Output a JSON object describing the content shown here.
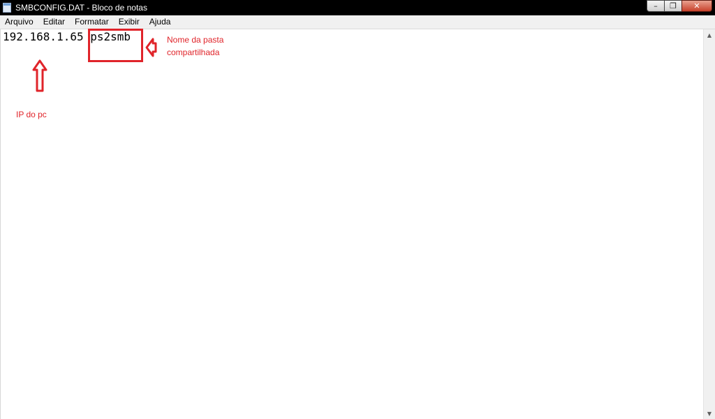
{
  "window": {
    "title": "SMBCONFIG.DAT - Bloco de notas",
    "minimize_glyph": "–",
    "maximize_glyph": "❐",
    "close_glyph": "✕"
  },
  "menu": {
    "items": [
      "Arquivo",
      "Editar",
      "Formatar",
      "Exibir",
      "Ajuda"
    ]
  },
  "editor": {
    "content": "192.168.1.65 ps2smb"
  },
  "annotations": {
    "folder_label": "Nome da pasta compartilhada",
    "ip_label": "IP do pc",
    "color": "#e0242a"
  },
  "scrollbar": {
    "up_glyph": "▲",
    "down_glyph": "▼"
  }
}
